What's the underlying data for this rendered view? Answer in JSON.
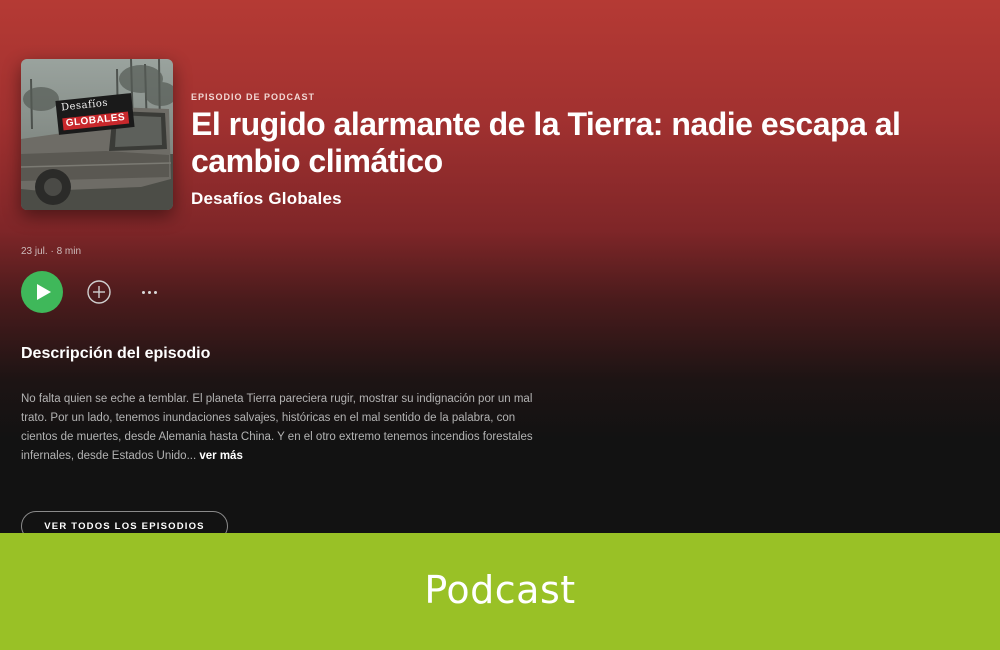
{
  "header": {
    "eyebrow": "EPISODIO DE PODCAST",
    "title": "El rugido alarmante de la Tierra: nadie escapa al cambio climático",
    "show_name": "Desafíos Globales",
    "cover": {
      "logo_line1": "Desafíos",
      "logo_line2": "GLOBALES"
    }
  },
  "episode": {
    "meta": "23 jul. · 8 min"
  },
  "controls": {
    "play_icon": "play-icon",
    "add_icon": "plus-circle-icon",
    "more_icon": "more-horizontal-icon",
    "play_color": "#3fb85a"
  },
  "description": {
    "heading": "Descripción del episodio",
    "body": "No falta quien se eche a temblar. El planeta Tierra pareciera rugir, mostrar su indignación por un mal trato. Por un lado, tenemos inundaciones salvajes, históricas en el mal sentido de la palabra, con cientos de muertes, desde Alemania hasta China. Y en el otro extremo tenemos incendios forestales infernales, desde Estados Unido...",
    "see_more": "ver más"
  },
  "all_episodes_label": "VER TODOS LOS EPISODIOS",
  "footer": {
    "label": "Podcast",
    "color": "#99c126"
  },
  "colors": {
    "header_red": "#b53a34",
    "background": "#121212"
  }
}
